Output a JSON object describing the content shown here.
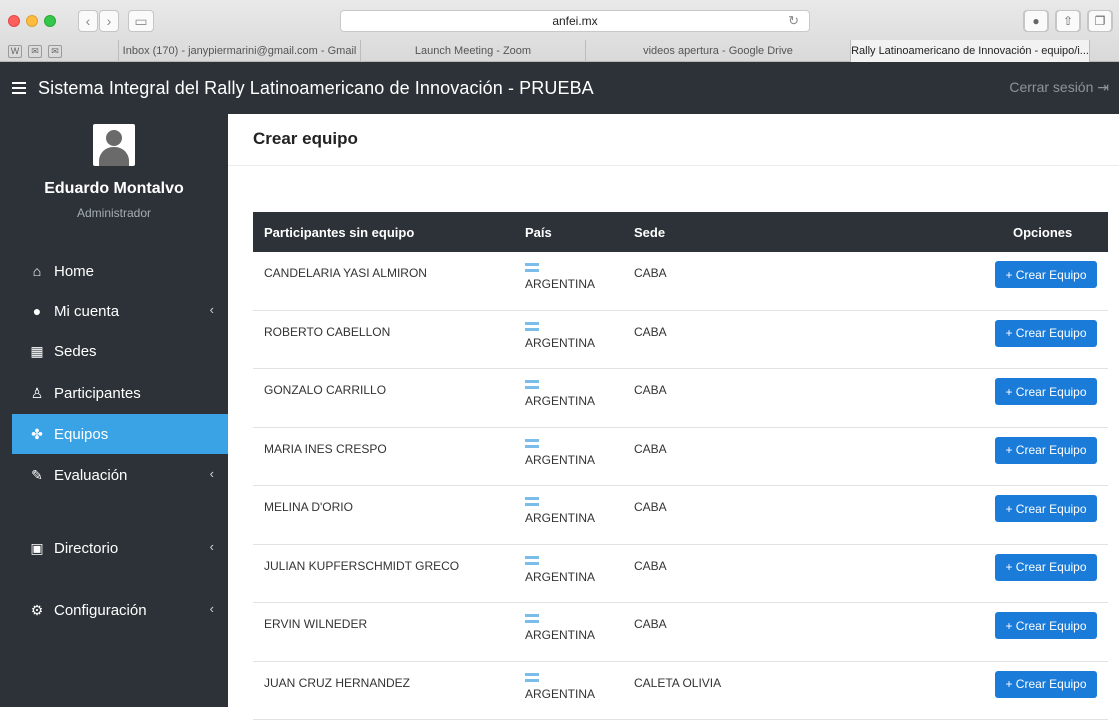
{
  "browser": {
    "url": "anfei.mx",
    "bookmarks": [
      "W",
      "✉",
      "✉"
    ],
    "tabs": [
      {
        "label": "Inbox (170) - janypiermarini@gmail.com - Gmail",
        "active": false
      },
      {
        "label": "Launch Meeting - Zoom",
        "active": false
      },
      {
        "label": "videos apertura - Google Drive",
        "active": false
      },
      {
        "label": "Rally Latinoamericano de Innovación - equipo/i...",
        "active": true
      }
    ]
  },
  "header": {
    "title": "Sistema Integral del Rally Latinoamericano de Innovación - PRUEBA",
    "logout": "Cerrar sesión"
  },
  "sidebar": {
    "user_name": "Eduardo Montalvo",
    "user_role": "Administrador",
    "items": [
      {
        "label": "Home",
        "icon": "home-icon",
        "glyph": "⌂",
        "chevron": false,
        "active": false
      },
      {
        "label": "Mi cuenta",
        "icon": "user-icon",
        "glyph": "●",
        "chevron": true,
        "active": false
      },
      {
        "label": "Sedes",
        "icon": "building-icon",
        "glyph": "▦",
        "chevron": false,
        "active": false
      },
      {
        "label": "Participantes",
        "icon": "person-icon",
        "glyph": "♙",
        "chevron": false,
        "active": false
      },
      {
        "label": "Equipos",
        "icon": "users-icon",
        "glyph": "✤",
        "chevron": false,
        "active": true
      },
      {
        "label": "Evaluación",
        "icon": "edit-icon",
        "glyph": "✎",
        "chevron": true,
        "active": false
      },
      {
        "label": "Directorio",
        "icon": "address-book-icon",
        "glyph": "▣",
        "chevron": true,
        "active": false
      },
      {
        "label": "Configuración",
        "icon": "cogs-icon",
        "glyph": "⚙",
        "chevron": true,
        "active": false
      }
    ]
  },
  "main": {
    "title": "Crear equipo",
    "table": {
      "headers": [
        "Participantes sin equipo",
        "País",
        "Sede",
        "Opciones"
      ],
      "button_label": "+ Crear Equipo",
      "rows": [
        {
          "name": "CANDELARIA YASI ALMIRON",
          "country": "ARGENTINA",
          "sede": "CABA"
        },
        {
          "name": "ROBERTO CABELLON",
          "country": "ARGENTINA",
          "sede": "CABA"
        },
        {
          "name": "GONZALO CARRILLO",
          "country": "ARGENTINA",
          "sede": "CABA"
        },
        {
          "name": "MARIA INES CRESPO",
          "country": "ARGENTINA",
          "sede": "CABA"
        },
        {
          "name": "MELINA D'ORIO",
          "country": "ARGENTINA",
          "sede": "CABA"
        },
        {
          "name": "JULIAN KUPFERSCHMIDT GRECO",
          "country": "ARGENTINA",
          "sede": "CABA"
        },
        {
          "name": "ERVIN WILNEDER",
          "country": "ARGENTINA",
          "sede": "CABA"
        },
        {
          "name": "JUAN CRUZ HERNANDEZ",
          "country": "ARGENTINA",
          "sede": "CALETA OLIVIA"
        }
      ]
    }
  },
  "colors": {
    "dark": "#2c3237",
    "active_menu": "#3aa3e6",
    "button": "#1a7bd8"
  }
}
